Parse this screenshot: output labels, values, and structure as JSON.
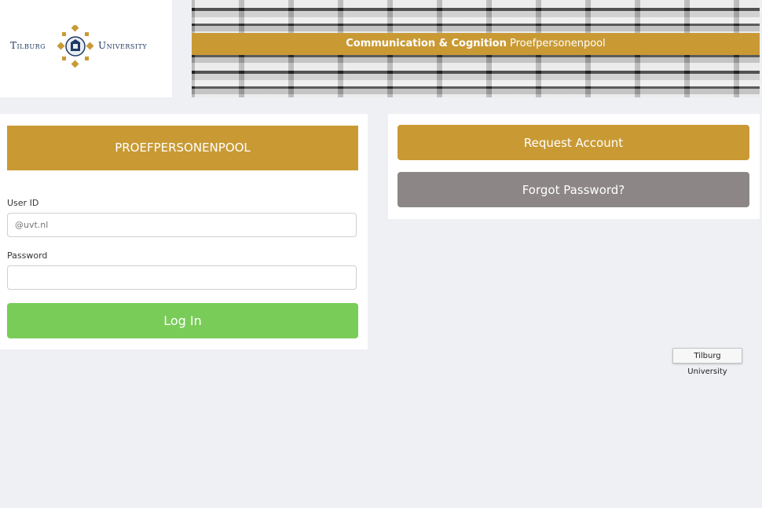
{
  "logo": {
    "left_word": "Tilburg",
    "right_word": "University"
  },
  "banner": {
    "bold_text": "Communication & Cognition",
    "normal_text": "Proefpersonenpool"
  },
  "login": {
    "header": "PROEFPERSONENPOOL",
    "user_label": "User ID",
    "user_placeholder": "@uvt.nl",
    "password_label": "Password",
    "button": "Log In"
  },
  "actions": {
    "request_account": "Request Account",
    "forgot_password": "Forgot Password?"
  },
  "tooltip": "Tilburg University",
  "colors": {
    "gold": "#c99a34",
    "green": "#79cc58",
    "gray": "#8c8786",
    "navy": "#1f3a63"
  }
}
